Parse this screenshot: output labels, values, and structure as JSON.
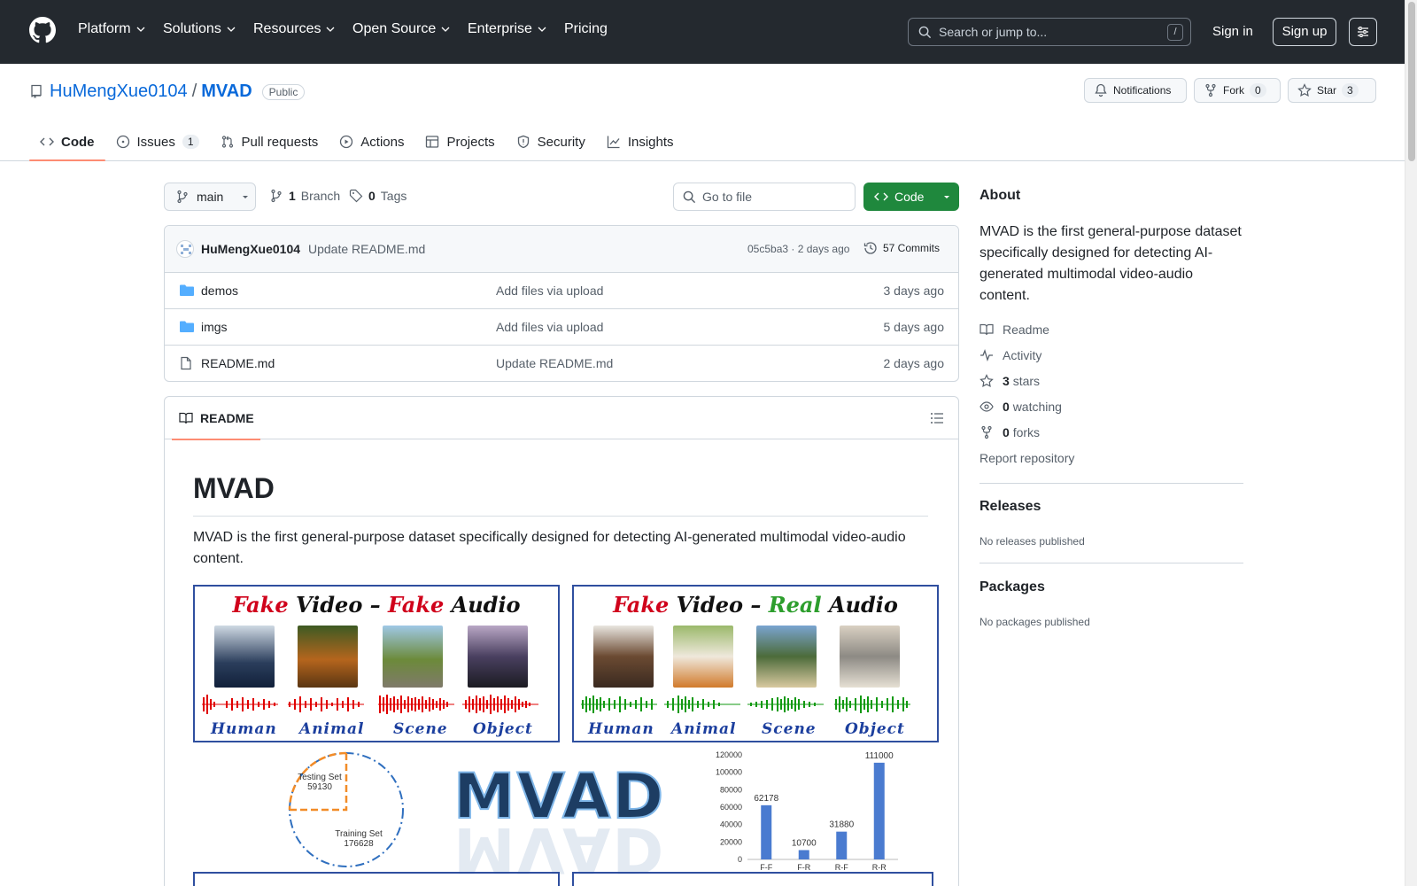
{
  "nav": {
    "items": [
      "Platform",
      "Solutions",
      "Resources",
      "Open Source",
      "Enterprise",
      "Pricing"
    ],
    "search_placeholder": "Search or jump to...",
    "search_shortcut": "/",
    "signin": "Sign in",
    "signup": "Sign up"
  },
  "repo": {
    "owner": "HuMengXue0104",
    "separator": "/",
    "name": "MVAD",
    "visibility": "Public",
    "notifications": "Notifications",
    "fork_label": "Fork",
    "fork_count": "0",
    "star_label": "Star",
    "star_count": "3"
  },
  "tabs": [
    {
      "label": "Code",
      "icon": "code-icon"
    },
    {
      "label": "Issues",
      "icon": "issue-icon",
      "count": "1"
    },
    {
      "label": "Pull requests",
      "icon": "pull-request-icon"
    },
    {
      "label": "Actions",
      "icon": "play-icon"
    },
    {
      "label": "Projects",
      "icon": "table-icon"
    },
    {
      "label": "Security",
      "icon": "shield-icon"
    },
    {
      "label": "Insights",
      "icon": "graph-icon"
    }
  ],
  "toolbar": {
    "branch": "main",
    "branch_count": "1",
    "branch_label": "Branch",
    "tag_count": "0",
    "tag_label": "Tags",
    "go_to_file": "Go to file",
    "code_button": "Code"
  },
  "commit": {
    "author": "HuMengXue0104",
    "message": "Update README.md",
    "sha_time": "05c5ba3 · 2 days ago",
    "commits": "57 Commits"
  },
  "files": [
    {
      "name": "demos",
      "type": "folder",
      "message": "Add files via upload",
      "date": "3 days ago"
    },
    {
      "name": "imgs",
      "type": "folder",
      "message": "Add files via upload",
      "date": "5 days ago"
    },
    {
      "name": "README.md",
      "type": "file",
      "message": "Update README.md",
      "date": "2 days ago"
    }
  ],
  "readme": {
    "tab": "README",
    "h1": "MVAD",
    "paragraph": "MVAD is the first general-purpose dataset specifically designed for detecting AI-generated multimodal video-audio content.",
    "figure": {
      "panel_left": {
        "title_parts": [
          "Fake",
          " Video",
          " – ",
          "Fake",
          " Audio"
        ],
        "labels": [
          "Human",
          "Animal",
          "Scene",
          "Object"
        ],
        "wave_color": "#e00000"
      },
      "panel_right": {
        "title_parts": [
          "Fake",
          " Video",
          " – ",
          "Real",
          " Audio"
        ],
        "labels": [
          "Human",
          "Animal",
          "Scene",
          "Object"
        ],
        "wave_color": "#119911"
      },
      "pie": {
        "testing_label": "Testing Set",
        "testing_value": "59130",
        "training_label": "Training Set",
        "training_value": "176628"
      },
      "logo": "MVAD",
      "bars": {
        "categories": [
          "F-F",
          "F-R",
          "R-F",
          "R-R"
        ],
        "values": [
          62178,
          10700,
          31880,
          111000
        ],
        "ticks": [
          "120000",
          "100000",
          "80000",
          "60000",
          "40000",
          "20000",
          "0"
        ],
        "ymax": 120000
      }
    }
  },
  "sidebar": {
    "about_heading": "About",
    "description": "MVAD is the first general-purpose dataset specifically designed for detecting AI-generated multimodal video-audio content.",
    "links": [
      {
        "icon": "book-icon",
        "count": "",
        "label": "Readme"
      },
      {
        "icon": "pulse-icon",
        "count": "",
        "label": "Activity"
      },
      {
        "icon": "star-icon",
        "count": "3",
        "label": "stars"
      },
      {
        "icon": "eye-icon",
        "count": "0",
        "label": "watching"
      },
      {
        "icon": "fork-icon",
        "count": "0",
        "label": "forks"
      }
    ],
    "report": "Report repository",
    "releases_heading": "Releases",
    "releases_note": "No releases published",
    "packages_heading": "Packages",
    "packages_note": "No packages published"
  },
  "colors": {
    "header_bg": "#24292f",
    "accent": "#0969da",
    "green": "#1f883d",
    "tab_underline": "#fd8c73"
  }
}
